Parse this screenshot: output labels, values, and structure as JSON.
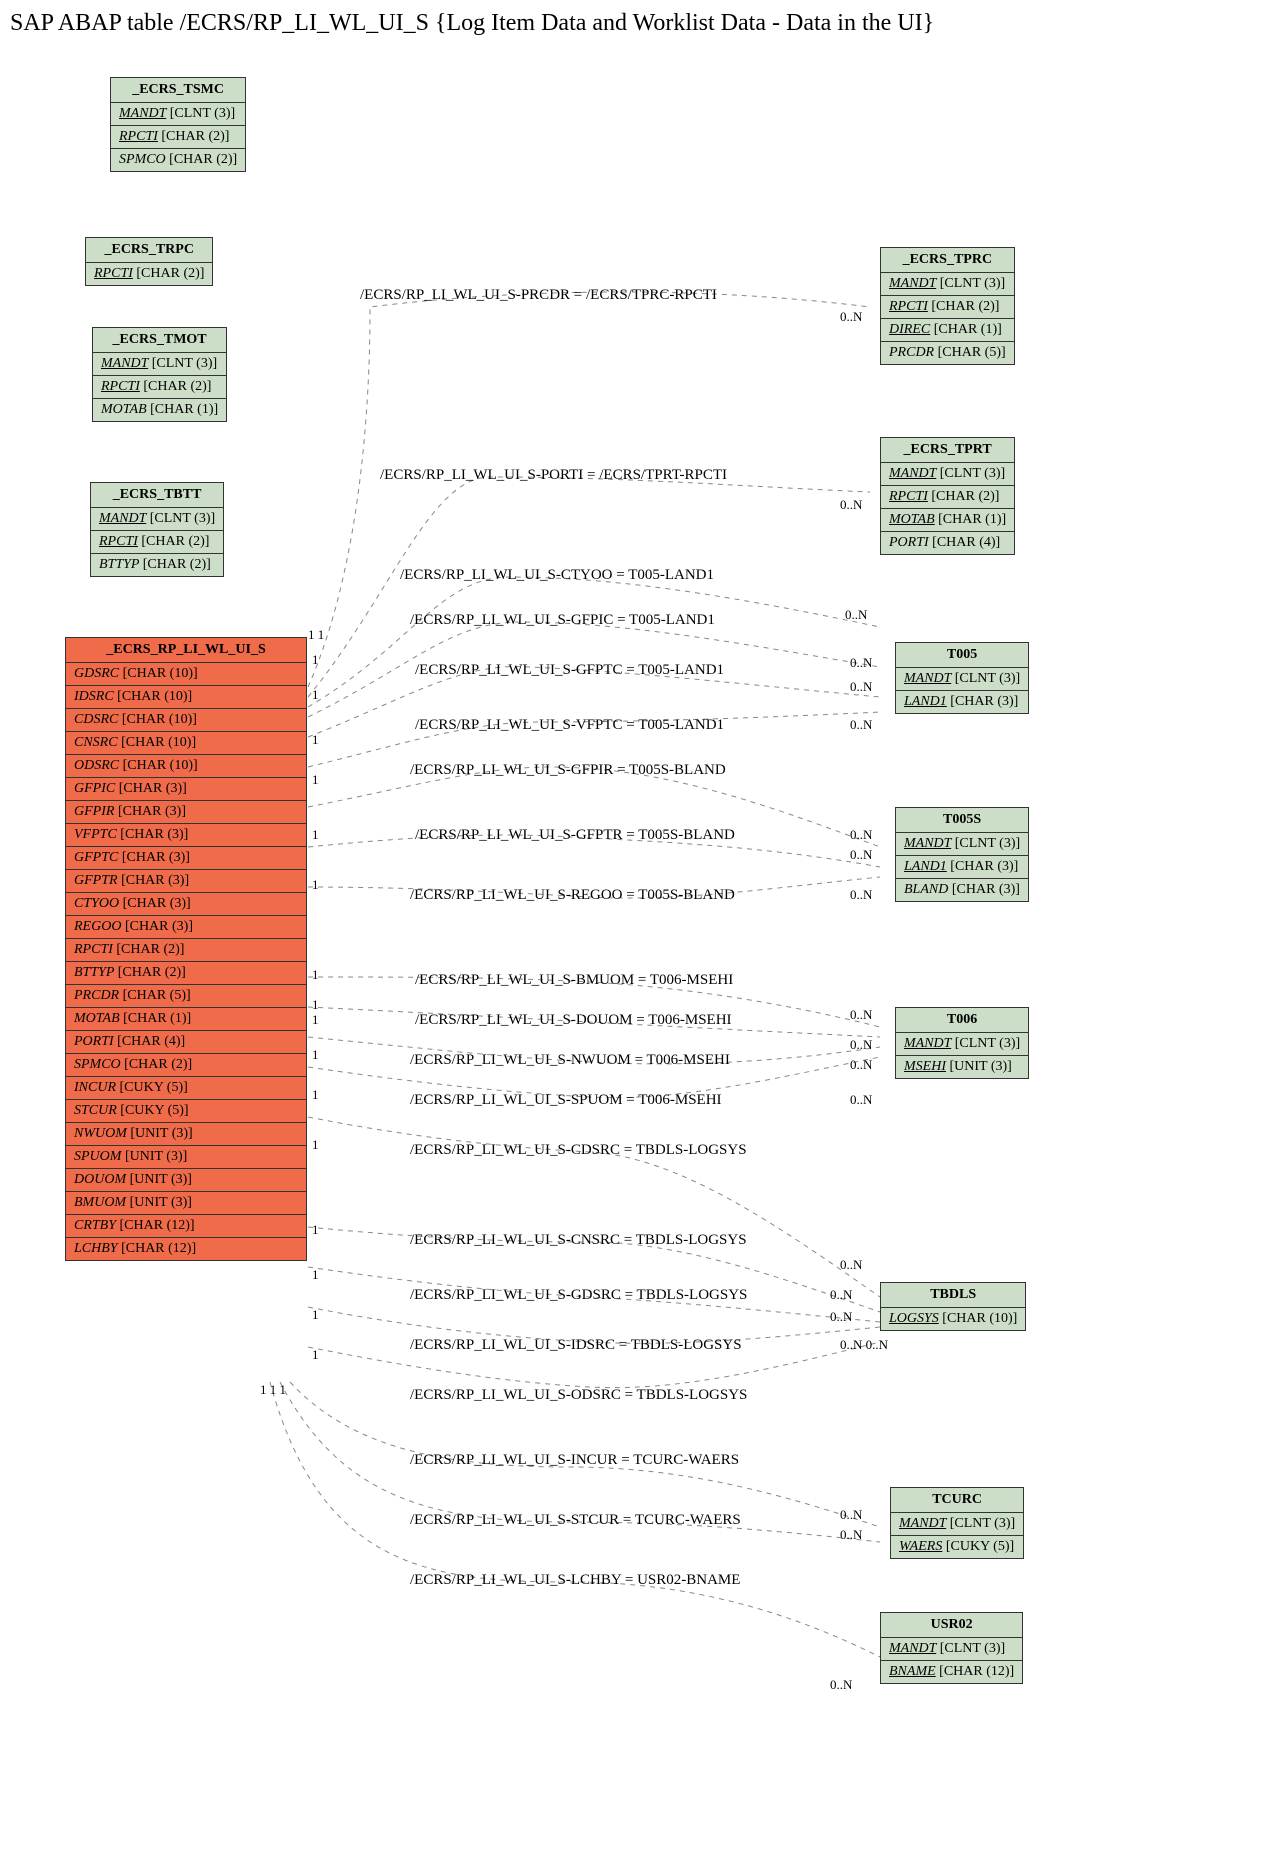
{
  "title": "SAP ABAP table /ECRS/RP_LI_WL_UI_S {Log Item Data and Worklist Data - Data in the UI}",
  "entities": {
    "tsmc": {
      "name": "_ECRS_TSMC",
      "fields": [
        {
          "key": true,
          "name": "MANDT",
          "type": "[CLNT (3)]"
        },
        {
          "key": true,
          "name": "RPCTI",
          "type": "[CHAR (2)]"
        },
        {
          "key": false,
          "name": "SPMCO",
          "type": "[CHAR (2)]"
        }
      ]
    },
    "trpc": {
      "name": "_ECRS_TRPC",
      "fields": [
        {
          "key": true,
          "name": "RPCTI",
          "type": "[CHAR (2)]"
        }
      ]
    },
    "tmot": {
      "name": "_ECRS_TMOT",
      "fields": [
        {
          "key": true,
          "name": "MANDT",
          "type": "[CLNT (3)]"
        },
        {
          "key": true,
          "name": "RPCTI",
          "type": "[CHAR (2)]"
        },
        {
          "key": false,
          "name": "MOTAB",
          "type": "[CHAR (1)]"
        }
      ]
    },
    "tbtt": {
      "name": "_ECRS_TBTT",
      "fields": [
        {
          "key": true,
          "name": "MANDT",
          "type": "[CLNT (3)]"
        },
        {
          "key": true,
          "name": "RPCTI",
          "type": "[CHAR (2)]"
        },
        {
          "key": false,
          "name": "BTTYP",
          "type": "[CHAR (2)]"
        }
      ]
    },
    "main": {
      "name": "_ECRS_RP_LI_WL_UI_S",
      "fields": [
        {
          "name": "GDSRC",
          "type": "[CHAR (10)]"
        },
        {
          "name": "IDSRC",
          "type": "[CHAR (10)]"
        },
        {
          "name": "CDSRC",
          "type": "[CHAR (10)]"
        },
        {
          "name": "CNSRC",
          "type": "[CHAR (10)]"
        },
        {
          "name": "ODSRC",
          "type": "[CHAR (10)]"
        },
        {
          "name": "GFPIC",
          "type": "[CHAR (3)]"
        },
        {
          "name": "GFPIR",
          "type": "[CHAR (3)]"
        },
        {
          "name": "VFPTC",
          "type": "[CHAR (3)]"
        },
        {
          "name": "GFPTC",
          "type": "[CHAR (3)]"
        },
        {
          "name": "GFPTR",
          "type": "[CHAR (3)]"
        },
        {
          "name": "CTYOO",
          "type": "[CHAR (3)]"
        },
        {
          "name": "REGOO",
          "type": "[CHAR (3)]"
        },
        {
          "name": "RPCTI",
          "type": "[CHAR (2)]"
        },
        {
          "name": "BTTYP",
          "type": "[CHAR (2)]"
        },
        {
          "name": "PRCDR",
          "type": "[CHAR (5)]"
        },
        {
          "name": "MOTAB",
          "type": "[CHAR (1)]"
        },
        {
          "name": "PORTI",
          "type": "[CHAR (4)]"
        },
        {
          "name": "SPMCO",
          "type": "[CHAR (2)]"
        },
        {
          "name": "INCUR",
          "type": "[CUKY (5)]"
        },
        {
          "name": "STCUR",
          "type": "[CUKY (5)]"
        },
        {
          "name": "NWUOM",
          "type": "[UNIT (3)]"
        },
        {
          "name": "SPUOM",
          "type": "[UNIT (3)]"
        },
        {
          "name": "DOUOM",
          "type": "[UNIT (3)]"
        },
        {
          "name": "BMUOM",
          "type": "[UNIT (3)]"
        },
        {
          "name": "CRTBY",
          "type": "[CHAR (12)]"
        },
        {
          "name": "LCHBY",
          "type": "[CHAR (12)]"
        }
      ]
    },
    "tprc": {
      "name": "_ECRS_TPRC",
      "fields": [
        {
          "key": true,
          "name": "MANDT",
          "type": "[CLNT (3)]"
        },
        {
          "key": true,
          "name": "RPCTI",
          "type": "[CHAR (2)]"
        },
        {
          "key": true,
          "name": "DIREC",
          "type": "[CHAR (1)]"
        },
        {
          "key": false,
          "name": "PRCDR",
          "type": "[CHAR (5)]"
        }
      ]
    },
    "tprt": {
      "name": "_ECRS_TPRT",
      "fields": [
        {
          "key": true,
          "name": "MANDT",
          "type": "[CLNT (3)]"
        },
        {
          "key": true,
          "name": "RPCTI",
          "type": "[CHAR (2)]"
        },
        {
          "key": true,
          "name": "MOTAB",
          "type": "[CHAR (1)]"
        },
        {
          "key": false,
          "name": "PORTI",
          "type": "[CHAR (4)]"
        }
      ]
    },
    "t005": {
      "name": "T005",
      "fields": [
        {
          "key": true,
          "name": "MANDT",
          "type": "[CLNT (3)]"
        },
        {
          "key": true,
          "name": "LAND1",
          "type": "[CHAR (3)]"
        }
      ]
    },
    "t005s": {
      "name": "T005S",
      "fields": [
        {
          "key": true,
          "name": "MANDT",
          "type": "[CLNT (3)]"
        },
        {
          "key": true,
          "name": "LAND1",
          "type": "[CHAR (3)]"
        },
        {
          "key": false,
          "name": "BLAND",
          "type": "[CHAR (3)]"
        }
      ]
    },
    "t006": {
      "name": "T006",
      "fields": [
        {
          "key": true,
          "name": "MANDT",
          "type": "[CLNT (3)]"
        },
        {
          "key": true,
          "name": "MSEHI",
          "type": "[UNIT (3)]"
        }
      ]
    },
    "tbdls": {
      "name": "TBDLS",
      "fields": [
        {
          "key": true,
          "name": "LOGSYS",
          "type": "[CHAR (10)]"
        }
      ]
    },
    "tcurc": {
      "name": "TCURC",
      "fields": [
        {
          "key": true,
          "name": "MANDT",
          "type": "[CLNT (3)]"
        },
        {
          "key": true,
          "name": "WAERS",
          "type": "[CUKY (5)]"
        }
      ]
    },
    "usr02": {
      "name": "USR02",
      "fields": [
        {
          "key": true,
          "name": "MANDT",
          "type": "[CLNT (3)]"
        },
        {
          "key": true,
          "name": "BNAME",
          "type": "[CHAR (12)]"
        }
      ]
    }
  },
  "relations": [
    {
      "text": "/ECRS/RP_LI_WL_UI_S-PRCDR = /ECRS/TPRC-RPCTI"
    },
    {
      "text": "/ECRS/RP_LI_WL_UI_S-PORTI = /ECRS/TPRT-RPCTI"
    },
    {
      "text": "/ECRS/RP_LI_WL_UI_S-CTYOO = T005-LAND1"
    },
    {
      "text": "/ECRS/RP_LI_WL_UI_S-GFPIC = T005-LAND1"
    },
    {
      "text": "/ECRS/RP_LI_WL_UI_S-GFPTC = T005-LAND1"
    },
    {
      "text": "/ECRS/RP_LI_WL_UI_S-VFPTC = T005-LAND1"
    },
    {
      "text": "/ECRS/RP_LI_WL_UI_S-GFPIR = T005S-BLAND"
    },
    {
      "text": "/ECRS/RP_LI_WL_UI_S-GFPTR = T005S-BLAND"
    },
    {
      "text": "/ECRS/RP_LI_WL_UI_S-REGOO = T005S-BLAND"
    },
    {
      "text": "/ECRS/RP_LI_WL_UI_S-BMUOM = T006-MSEHI"
    },
    {
      "text": "/ECRS/RP_LI_WL_UI_S-DOUOM = T006-MSEHI"
    },
    {
      "text": "/ECRS/RP_LI_WL_UI_S-NWUOM = T006-MSEHI"
    },
    {
      "text": "/ECRS/RP_LI_WL_UI_S-SPUOM = T006-MSEHI"
    },
    {
      "text": "/ECRS/RP_LI_WL_UI_S-CDSRC = TBDLS-LOGSYS"
    },
    {
      "text": "/ECRS/RP_LI_WL_UI_S-CNSRC = TBDLS-LOGSYS"
    },
    {
      "text": "/ECRS/RP_LI_WL_UI_S-GDSRC = TBDLS-LOGSYS"
    },
    {
      "text": "/ECRS/RP_LI_WL_UI_S-IDSRC = TBDLS-LOGSYS"
    },
    {
      "text": "/ECRS/RP_LI_WL_UI_S-ODSRC = TBDLS-LOGSYS"
    },
    {
      "text": "/ECRS/RP_LI_WL_UI_S-INCUR = TCURC-WAERS"
    },
    {
      "text": "/ECRS/RP_LI_WL_UI_S-STCUR = TCURC-WAERS"
    },
    {
      "text": "/ECRS/RP_LI_WL_UI_S-LCHBY = USR02-BNAME"
    }
  ],
  "cards": {
    "one": "1",
    "oneone": "1 1",
    "zeroN": "0..N"
  }
}
